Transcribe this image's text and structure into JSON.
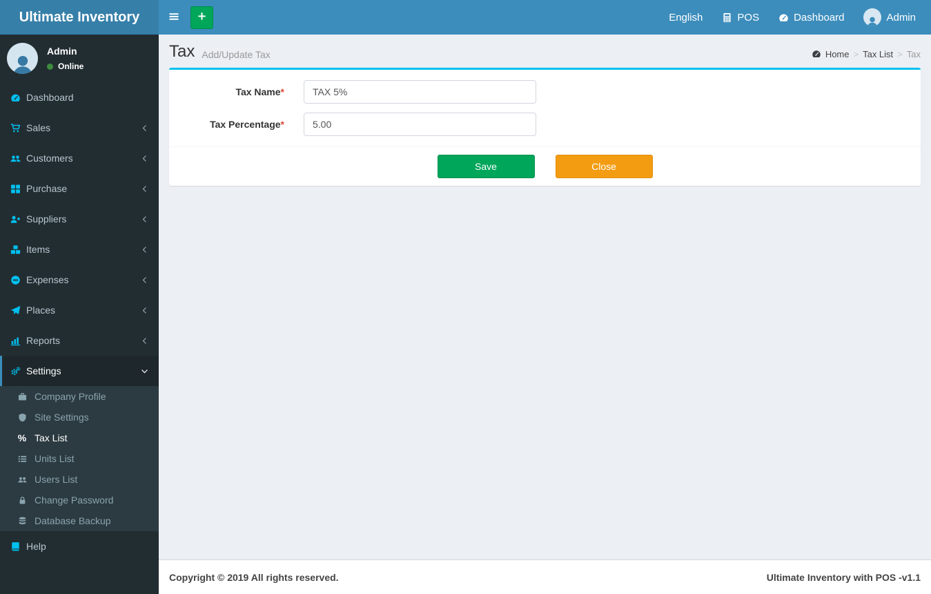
{
  "colors": {
    "navbar_blue": "#3c8dbc",
    "logo_blue": "#367fa9",
    "sidebar_dark": "#222d32",
    "submenu_dark": "#2c3b41",
    "sidebar_text": "#b8c7ce",
    "submenu_text": "#8aa4af",
    "menu_icon_cyan": "#00c0ef",
    "active_border_blue": "#3c8dbc",
    "box_accent_cyan": "#00c0ef",
    "save_green": "#00a65a",
    "close_orange": "#f39c12",
    "online_green": "#3d8b3d",
    "required_red": "#dd4b39",
    "content_bg": "#ecf0f5"
  },
  "app": {
    "title": "Ultimate Inventory"
  },
  "navbar": {
    "items": [
      {
        "label": "English",
        "icon": null
      },
      {
        "label": "POS",
        "icon": "calculator"
      },
      {
        "label": "Dashboard",
        "icon": "tachometer"
      },
      {
        "label": "Admin",
        "icon": "avatar"
      }
    ]
  },
  "sidebar": {
    "user": {
      "name": "Admin",
      "status": "Online"
    },
    "menu": [
      {
        "label": "Dashboard",
        "icon": "tachometer"
      },
      {
        "label": "Sales",
        "icon": "cart",
        "arrow": "left"
      },
      {
        "label": "Customers",
        "icon": "users",
        "arrow": "left"
      },
      {
        "label": "Purchase",
        "icon": "grid",
        "arrow": "left"
      },
      {
        "label": "Suppliers",
        "icon": "user-plus",
        "arrow": "left"
      },
      {
        "label": "Items",
        "icon": "cubes",
        "arrow": "left"
      },
      {
        "label": "Expenses",
        "icon": "minus-circle",
        "arrow": "left"
      },
      {
        "label": "Places",
        "icon": "paper-plane",
        "arrow": "left"
      },
      {
        "label": "Reports",
        "icon": "bar-chart",
        "arrow": "left"
      },
      {
        "label": "Settings",
        "icon": "gears",
        "arrow": "down",
        "active": true,
        "children": [
          {
            "label": "Company Profile",
            "icon": "briefcase"
          },
          {
            "label": "Site Settings",
            "icon": "shield"
          },
          {
            "label": "Tax List",
            "icon": "percent",
            "active": true
          },
          {
            "label": "Units List",
            "icon": "list"
          },
          {
            "label": "Users List",
            "icon": "users"
          },
          {
            "label": "Change Password",
            "icon": "lock"
          },
          {
            "label": "Database Backup",
            "icon": "database"
          }
        ]
      },
      {
        "label": "Help",
        "icon": "book"
      }
    ]
  },
  "page": {
    "title": "Tax",
    "subtitle": "Add/Update Tax",
    "breadcrumb": {
      "separator": ">",
      "items": [
        {
          "label": "Home",
          "icon": "tachometer"
        },
        {
          "label": "Tax List"
        },
        {
          "label": "Tax",
          "current": true
        }
      ]
    }
  },
  "form": {
    "required_marker": "*",
    "fields": [
      {
        "label": "Tax Name",
        "required": true,
        "value": "TAX 5%",
        "name": "tax-name"
      },
      {
        "label": "Tax Percentage",
        "required": true,
        "value": "5.00",
        "name": "tax-percentage"
      }
    ],
    "buttons": {
      "save": "Save",
      "close": "Close"
    }
  },
  "footer": {
    "left": "Copyright © 2019 All rights reserved.",
    "right": "Ultimate Inventory with POS -v1.1"
  }
}
